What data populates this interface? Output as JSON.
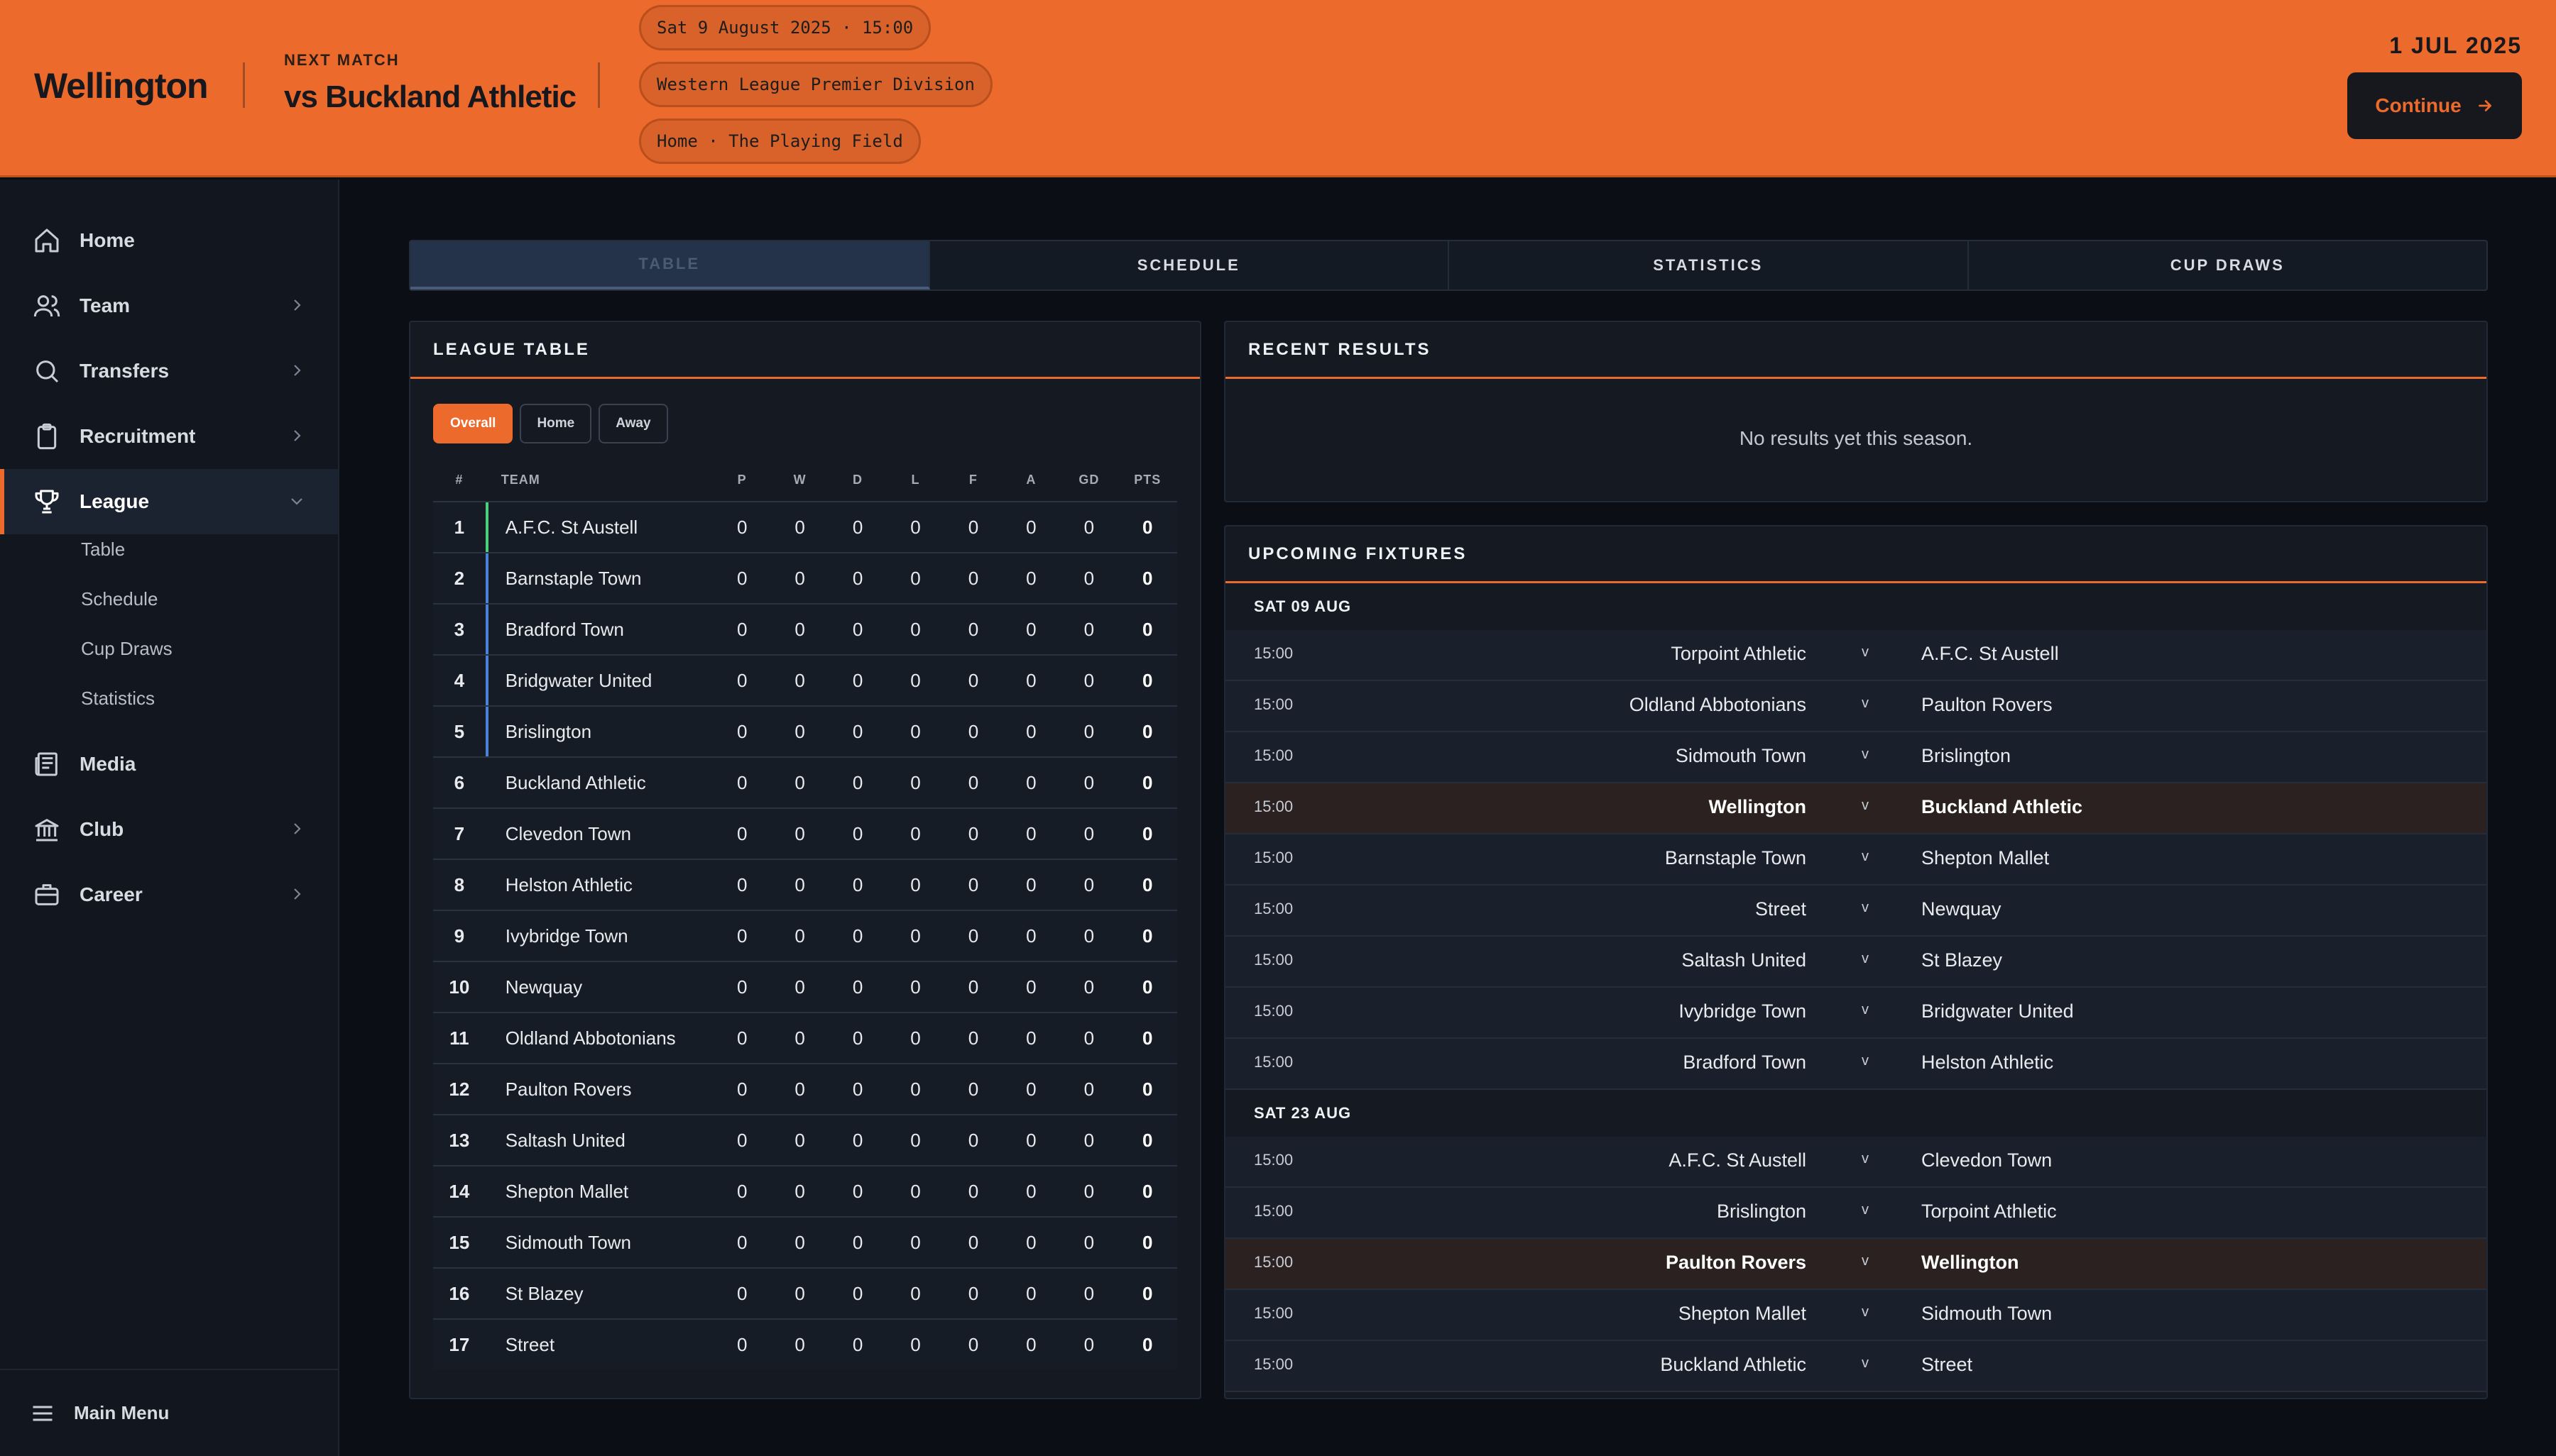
{
  "header": {
    "club_name": "Wellington",
    "next_match_label": "NEXT MATCH",
    "next_opponent": "vs Buckland Athletic",
    "pills": [
      "Sat 9 August 2025 · 15:00",
      "Western League Premier Division",
      "Home · The Playing Field"
    ],
    "date": "1 JUL 2025",
    "continue_label": "Continue"
  },
  "sidebar": {
    "items": [
      {
        "label": "Home",
        "icon": "home-icon"
      },
      {
        "label": "Team",
        "icon": "team-icon",
        "chevron": true
      },
      {
        "label": "Transfers",
        "icon": "search-icon",
        "chevron": true
      },
      {
        "label": "Recruitment",
        "icon": "clipboard-icon",
        "chevron": true
      },
      {
        "label": "League",
        "icon": "trophy-icon",
        "chevron": true,
        "active": true
      },
      {
        "label": "Media",
        "icon": "newspaper-icon"
      },
      {
        "label": "Club",
        "icon": "bank-icon",
        "chevron": true
      },
      {
        "label": "Career",
        "icon": "briefcase-icon",
        "chevron": true
      }
    ],
    "league_sub": [
      "Table",
      "Schedule",
      "Cup Draws",
      "Statistics"
    ],
    "footer_label": "Main Menu"
  },
  "tabs": [
    "TABLE",
    "SCHEDULE",
    "STATISTICS",
    "CUP DRAWS"
  ],
  "league_table": {
    "title": "LEAGUE TABLE",
    "filters": [
      "Overall",
      "Home",
      "Away"
    ],
    "columns": [
      "#",
      "TEAM",
      "P",
      "W",
      "D",
      "L",
      "F",
      "A",
      "GD",
      "PTS"
    ],
    "rows": [
      {
        "pos": "1",
        "team": "A.F.C. St Austell",
        "p": "0",
        "w": "0",
        "d": "0",
        "l": "0",
        "f": "0",
        "a": "0",
        "gd": "0",
        "pts": "0",
        "zone": "promo"
      },
      {
        "pos": "2",
        "team": "Barnstaple Town",
        "p": "0",
        "w": "0",
        "d": "0",
        "l": "0",
        "f": "0",
        "a": "0",
        "gd": "0",
        "pts": "0",
        "zone": "playoff"
      },
      {
        "pos": "3",
        "team": "Bradford Town",
        "p": "0",
        "w": "0",
        "d": "0",
        "l": "0",
        "f": "0",
        "a": "0",
        "gd": "0",
        "pts": "0",
        "zone": "playoff"
      },
      {
        "pos": "4",
        "team": "Bridgwater United",
        "p": "0",
        "w": "0",
        "d": "0",
        "l": "0",
        "f": "0",
        "a": "0",
        "gd": "0",
        "pts": "0",
        "zone": "playoff"
      },
      {
        "pos": "5",
        "team": "Brislington",
        "p": "0",
        "w": "0",
        "d": "0",
        "l": "0",
        "f": "0",
        "a": "0",
        "gd": "0",
        "pts": "0",
        "zone": "playoff"
      },
      {
        "pos": "6",
        "team": "Buckland Athletic",
        "p": "0",
        "w": "0",
        "d": "0",
        "l": "0",
        "f": "0",
        "a": "0",
        "gd": "0",
        "pts": "0"
      },
      {
        "pos": "7",
        "team": "Clevedon Town",
        "p": "0",
        "w": "0",
        "d": "0",
        "l": "0",
        "f": "0",
        "a": "0",
        "gd": "0",
        "pts": "0"
      },
      {
        "pos": "8",
        "team": "Helston Athletic",
        "p": "0",
        "w": "0",
        "d": "0",
        "l": "0",
        "f": "0",
        "a": "0",
        "gd": "0",
        "pts": "0"
      },
      {
        "pos": "9",
        "team": "Ivybridge Town",
        "p": "0",
        "w": "0",
        "d": "0",
        "l": "0",
        "f": "0",
        "a": "0",
        "gd": "0",
        "pts": "0"
      },
      {
        "pos": "10",
        "team": "Newquay",
        "p": "0",
        "w": "0",
        "d": "0",
        "l": "0",
        "f": "0",
        "a": "0",
        "gd": "0",
        "pts": "0"
      },
      {
        "pos": "11",
        "team": "Oldland Abbotonians",
        "p": "0",
        "w": "0",
        "d": "0",
        "l": "0",
        "f": "0",
        "a": "0",
        "gd": "0",
        "pts": "0"
      },
      {
        "pos": "12",
        "team": "Paulton Rovers",
        "p": "0",
        "w": "0",
        "d": "0",
        "l": "0",
        "f": "0",
        "a": "0",
        "gd": "0",
        "pts": "0"
      },
      {
        "pos": "13",
        "team": "Saltash United",
        "p": "0",
        "w": "0",
        "d": "0",
        "l": "0",
        "f": "0",
        "a": "0",
        "gd": "0",
        "pts": "0"
      },
      {
        "pos": "14",
        "team": "Shepton Mallet",
        "p": "0",
        "w": "0",
        "d": "0",
        "l": "0",
        "f": "0",
        "a": "0",
        "gd": "0",
        "pts": "0"
      },
      {
        "pos": "15",
        "team": "Sidmouth Town",
        "p": "0",
        "w": "0",
        "d": "0",
        "l": "0",
        "f": "0",
        "a": "0",
        "gd": "0",
        "pts": "0"
      },
      {
        "pos": "16",
        "team": "St Blazey",
        "p": "0",
        "w": "0",
        "d": "0",
        "l": "0",
        "f": "0",
        "a": "0",
        "gd": "0",
        "pts": "0"
      },
      {
        "pos": "17",
        "team": "Street",
        "p": "0",
        "w": "0",
        "d": "0",
        "l": "0",
        "f": "0",
        "a": "0",
        "gd": "0",
        "pts": "0"
      }
    ]
  },
  "recent_results": {
    "title": "RECENT RESULTS",
    "empty_message": "No results yet this season."
  },
  "upcoming_fixtures": {
    "title": "UPCOMING FIXTURES",
    "groups": [
      {
        "date": "SAT 09 AUG",
        "matches": [
          {
            "time": "15:00",
            "home": "Torpoint Athletic",
            "away": "A.F.C. St Austell"
          },
          {
            "time": "15:00",
            "home": "Oldland Abbotonians",
            "away": "Paulton Rovers"
          },
          {
            "time": "15:00",
            "home": "Sidmouth Town",
            "away": "Brislington"
          },
          {
            "time": "15:00",
            "home": "Wellington",
            "away": "Buckland Athletic",
            "mine": true
          },
          {
            "time": "15:00",
            "home": "Barnstaple Town",
            "away": "Shepton Mallet"
          },
          {
            "time": "15:00",
            "home": "Street",
            "away": "Newquay"
          },
          {
            "time": "15:00",
            "home": "Saltash United",
            "away": "St Blazey"
          },
          {
            "time": "15:00",
            "home": "Ivybridge Town",
            "away": "Bridgwater United"
          },
          {
            "time": "15:00",
            "home": "Bradford Town",
            "away": "Helston Athletic"
          }
        ]
      },
      {
        "date": "SAT 23 AUG",
        "matches": [
          {
            "time": "15:00",
            "home": "A.F.C. St Austell",
            "away": "Clevedon Town"
          },
          {
            "time": "15:00",
            "home": "Brislington",
            "away": "Torpoint Athletic"
          },
          {
            "time": "15:00",
            "home": "Paulton Rovers",
            "away": "Wellington",
            "mine": true
          },
          {
            "time": "15:00",
            "home": "Shepton Mallet",
            "away": "Sidmouth Town"
          },
          {
            "time": "15:00",
            "home": "Buckland Athletic",
            "away": "Street"
          }
        ]
      }
    ],
    "vs_label": "v"
  },
  "colors": {
    "accent": "#ec6a2c",
    "promotion": "#4ccf7a",
    "playoff": "#4a82d8"
  }
}
